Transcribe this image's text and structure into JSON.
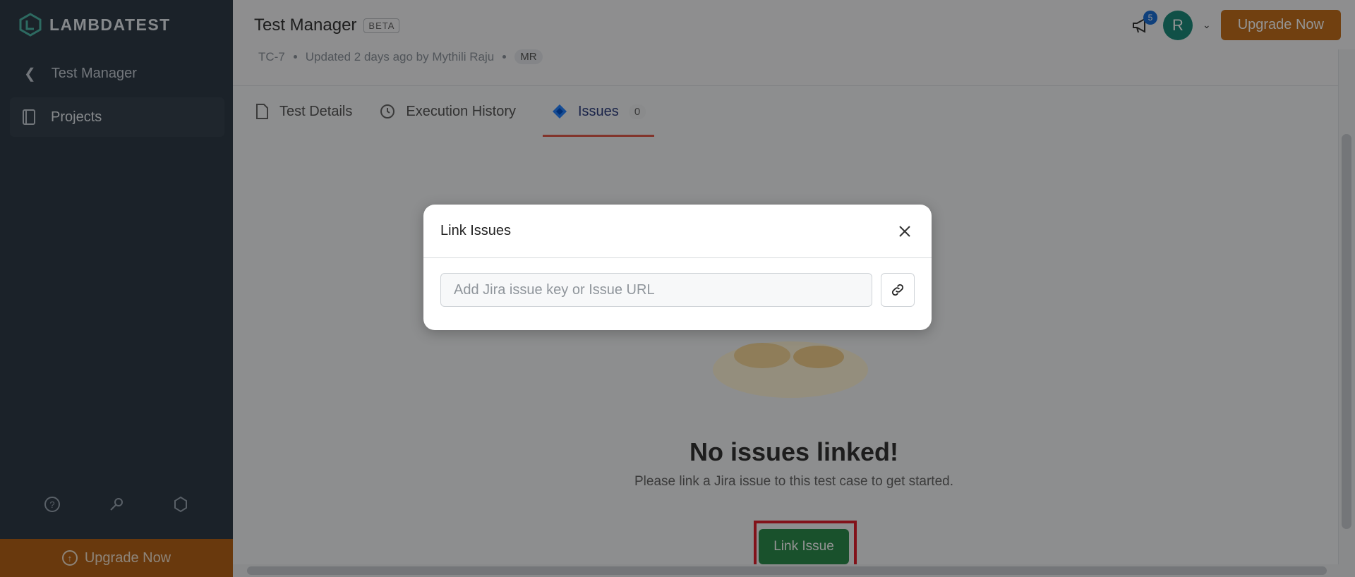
{
  "brand": {
    "logo_text": "LAMBDATEST"
  },
  "sidebar": {
    "back_label": "Test Manager",
    "items": [
      {
        "label": "Projects",
        "icon": "notebook-icon"
      }
    ],
    "footer_icons": [
      "help-icon",
      "key-icon",
      "integrations-icon"
    ],
    "upgrade_label": "Upgrade Now"
  },
  "header": {
    "title": "Test Manager",
    "badge": "BETA",
    "meta": {
      "id": "TC-7",
      "updated": "Updated 2 days ago by Mythili Raju",
      "initials": "MR"
    },
    "notifications_count": "5",
    "avatar_initial": "R",
    "upgrade_label": "Upgrade Now"
  },
  "tabs": [
    {
      "label": "Test Details",
      "icon": "document-icon"
    },
    {
      "label": "Execution History",
      "icon": "history-icon"
    },
    {
      "label": "Issues",
      "icon": "jira-icon",
      "count": "0",
      "active": true
    }
  ],
  "empty_state": {
    "title": "No issues linked!",
    "subtitle": "Please link a Jira issue to this test case to get started.",
    "button_label": "Link Issue"
  },
  "modal": {
    "title": "Link Issues",
    "input_placeholder": "Add Jira issue key or Issue URL",
    "input_value": ""
  },
  "colors": {
    "sidebar_bg": "#2f3b47",
    "upgrade": "#c36f1c",
    "link_issue_btn": "#2c8c4d",
    "highlight_frame": "#e01f2e"
  }
}
